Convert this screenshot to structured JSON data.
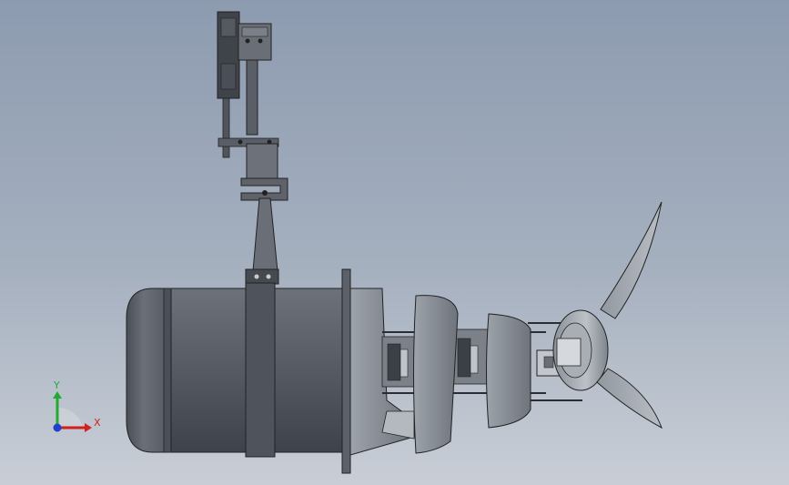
{
  "viewport": {
    "background_top": "#8d9bb0",
    "background_bottom": "#c9ced6"
  },
  "triad": {
    "y_label": "Y",
    "x_label": "X",
    "y_color": "#22aa33",
    "x_color": "#d02020",
    "z_color": "#2040d0"
  },
  "model": {
    "body_color": "#585d66",
    "metal_color": "#9aa0a8",
    "dark_part_color": "#3b3f46"
  }
}
